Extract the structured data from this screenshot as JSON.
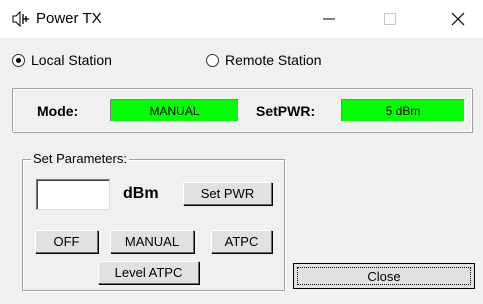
{
  "window": {
    "title": "Power TX",
    "minimize_icon": "minimize-icon",
    "maximize_icon": "maximize-icon",
    "close_icon": "close-icon"
  },
  "station": {
    "local_label": "Local Station",
    "remote_label": "Remote Station",
    "selected": "local"
  },
  "status": {
    "mode_label": "Mode:",
    "mode_value": "MANUAL",
    "setpwr_label": "SetPWR:",
    "setpwr_value": "5 dBm",
    "indicator_color": "#00ff00"
  },
  "parameters": {
    "group_title": "Set Parameters:",
    "input_value": "",
    "unit_label": "dBm",
    "set_pwr_label": "Set PWR",
    "off_label": "OFF",
    "manual_label": "MANUAL",
    "atpc_label": "ATPC",
    "level_atpc_label": "Level ATPC"
  },
  "footer": {
    "close_label": "Close"
  }
}
